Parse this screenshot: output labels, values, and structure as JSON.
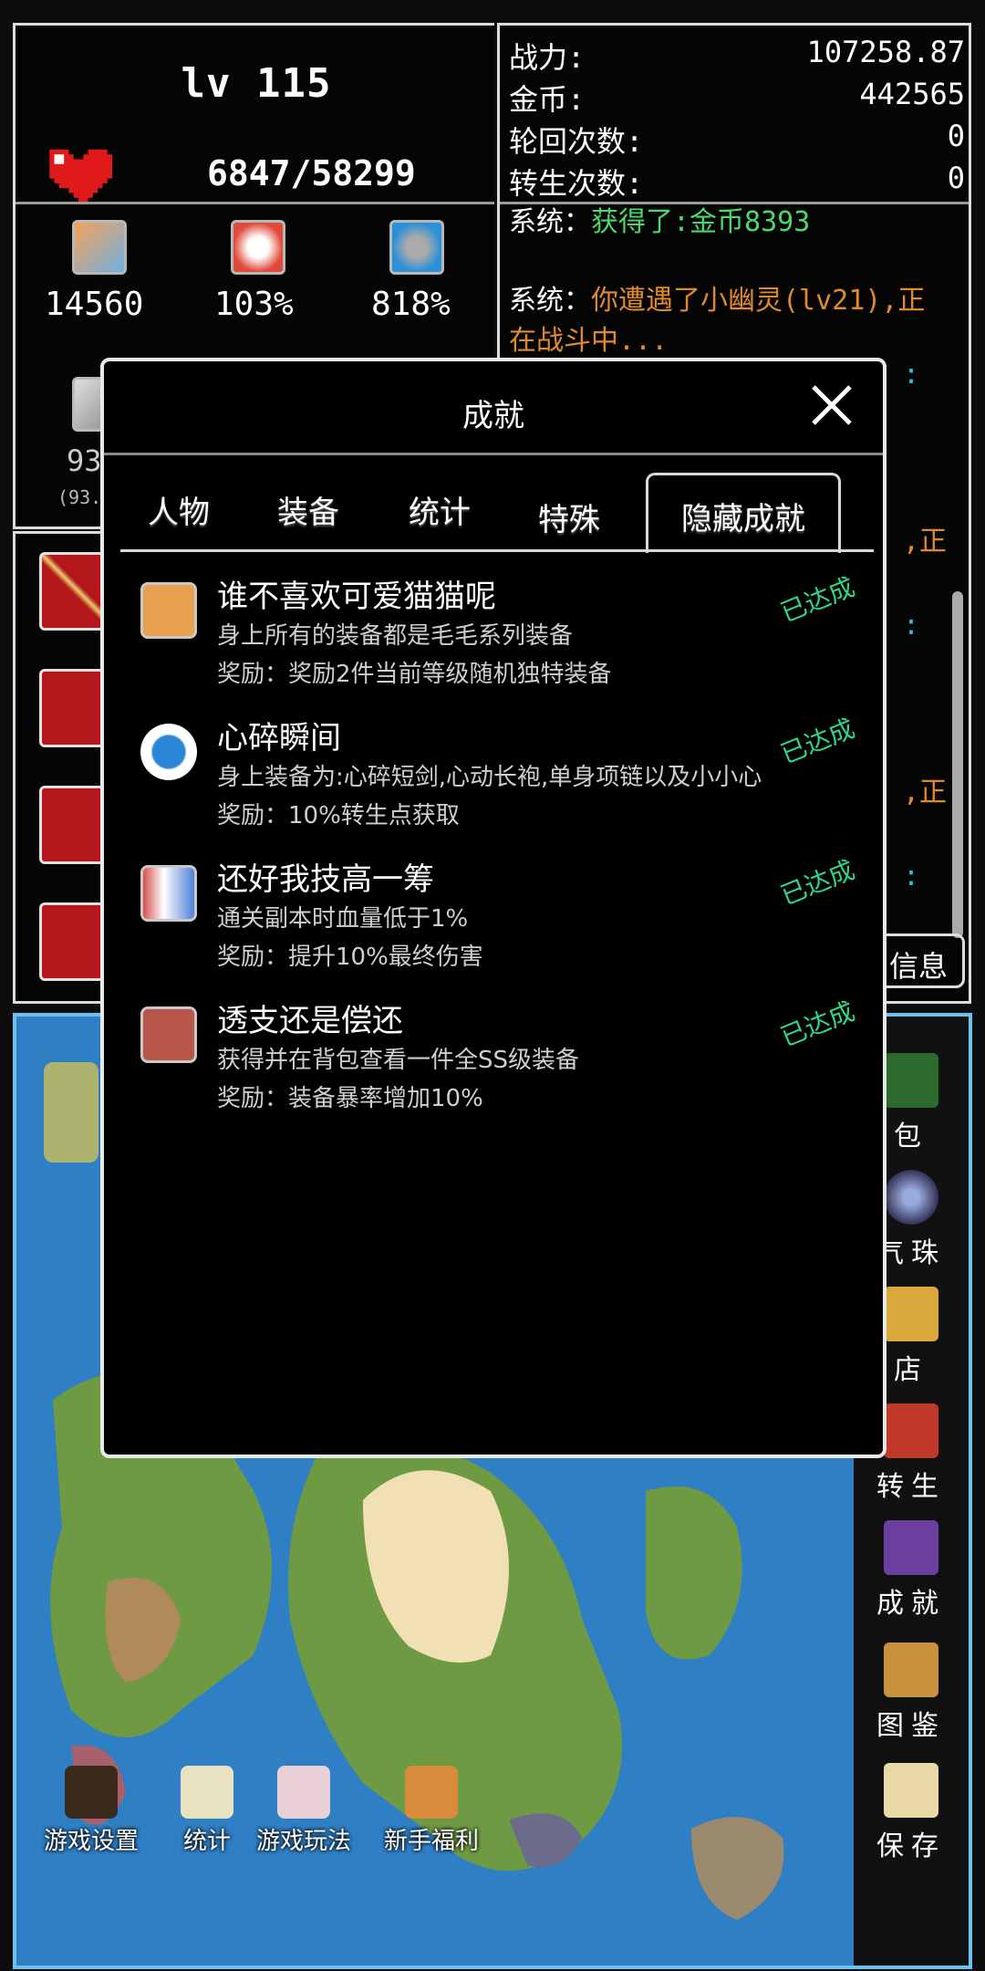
{
  "player": {
    "level": "lv 115",
    "hp": "6847/58299",
    "stats": [
      {
        "icon": "sword-icon",
        "value": "14560"
      },
      {
        "icon": "crit-icon",
        "value": "103%"
      },
      {
        "icon": "crit-damage-icon",
        "value": "818%"
      }
    ],
    "defense_partial": "93",
    "defense_sub_partial": "(93."
  },
  "stats_panel": {
    "rows": [
      {
        "label": "战力:",
        "value": "107258.87"
      },
      {
        "label": "金币:",
        "value": "442565"
      },
      {
        "label": "轮回次数:",
        "value": "0"
      },
      {
        "label": "转生次数:",
        "value": "0"
      }
    ],
    "log": [
      {
        "prefix": "系统：",
        "text": "获得了:金币8393"
      },
      {
        "prefix": "系统：",
        "text_line1": "你遭遇了小幽灵(lv21),正",
        "text_line2": "在战斗中..."
      }
    ],
    "partial_right": [
      ":",
      ",正",
      ":",
      ",正",
      ":"
    ],
    "info_button_partial": "信息"
  },
  "sidebar": {
    "items": [
      {
        "icon": "bag-icon",
        "label": "包"
      },
      {
        "icon": "orb-icon",
        "label": "气珠"
      },
      {
        "icon": "shop-icon",
        "label": "店"
      },
      {
        "icon": "rebirth-icon",
        "label": "转生"
      },
      {
        "icon": "achievement-icon",
        "label": "成就"
      },
      {
        "icon": "codex-icon",
        "label": "图鉴"
      },
      {
        "icon": "save-icon",
        "label": "保存"
      }
    ]
  },
  "bottom_bar": [
    {
      "icon": "settings-icon",
      "label": "游戏设置"
    },
    {
      "icon": "stats-icon",
      "label": "统计"
    },
    {
      "icon": "guide-icon",
      "label": "游戏玩法"
    },
    {
      "icon": "newbie-gift-icon",
      "label": "新手福利"
    }
  ],
  "modal": {
    "title": "成就",
    "tabs": [
      "人物",
      "装备",
      "统计",
      "特殊",
      "隐藏成就"
    ],
    "active_tab": "隐藏成就",
    "achievements": [
      {
        "icon": "cat-icon",
        "title": "谁不喜欢可爱猫猫呢",
        "desc": "身上所有的装备都是毛毛系列装备",
        "reward": "奖励：奖励2件当前等级随机独特装备",
        "status": "已达成"
      },
      {
        "icon": "broken-heart-icon",
        "title": "心碎瞬间",
        "desc": "身上装备为:心碎短剑,心动长袍,单身项链以及小小心",
        "reward": "奖励：10%转生点获取",
        "status": "已达成"
      },
      {
        "icon": "trick-icon",
        "title": "还好我技高一筹",
        "desc": "通关副本时血量低于1%",
        "reward": "奖励：提升10%最终伤害",
        "status": "已达成"
      },
      {
        "icon": "skull-icon",
        "title": "透支还是偿还",
        "desc": "获得并在背包查看一件全SS级装备",
        "reward": "奖励：装备暴率增加10%",
        "status": "已达成"
      }
    ]
  }
}
